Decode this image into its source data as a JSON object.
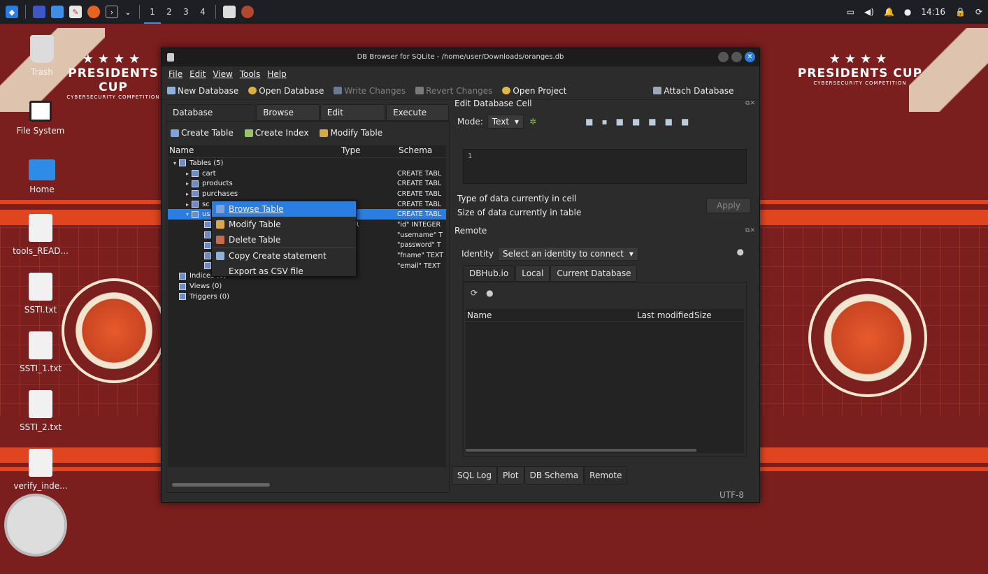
{
  "taskbar": {
    "workspaces": [
      "1",
      "2",
      "3",
      "4"
    ],
    "time": "14:16"
  },
  "desktop": {
    "banner_title": "PRESIDENTS CUP",
    "banner_subtitle": "CYBERSECURITY COMPETITION",
    "icons": [
      {
        "label": "Trash",
        "icon": "trash-icon"
      },
      {
        "label": "File System",
        "icon": "drive-icon"
      },
      {
        "label": "Home",
        "icon": "home-folder-icon"
      },
      {
        "label": "tools_READ...",
        "icon": "text-file-icon"
      },
      {
        "label": "SSTI.txt",
        "icon": "text-file-icon"
      },
      {
        "label": "SSTI_1.txt",
        "icon": "text-file-icon"
      },
      {
        "label": "SSTI_2.txt",
        "icon": "text-file-icon"
      },
      {
        "label": "verify_inde...",
        "icon": "script-file-icon"
      }
    ]
  },
  "window": {
    "title": "DB Browser for SQLite - /home/user/Downloads/oranges.db",
    "menu": [
      "File",
      "Edit",
      "View",
      "Tools",
      "Help"
    ],
    "toolbar": {
      "new_db": "New Database",
      "open_db": "Open Database",
      "write_changes": "Write Changes",
      "revert_changes": "Revert Changes",
      "open_project": "Open Project",
      "attach_db": "Attach Database"
    },
    "tabs": [
      "Database Structure",
      "Browse Data",
      "Edit Pragmas",
      "Execute SQL"
    ],
    "subtool": {
      "create_table": "Create Table",
      "create_index": "Create Index",
      "modify_table": "Modify Table"
    },
    "tree": {
      "columns": [
        "Name",
        "Type",
        "Schema"
      ],
      "rows": [
        {
          "name": "Tables (5)",
          "type": "",
          "schema": "",
          "indent": 0,
          "expand": "▾"
        },
        {
          "name": "cart",
          "type": "",
          "schema": "CREATE TABL",
          "indent": 1,
          "expand": "▸"
        },
        {
          "name": "products",
          "type": "",
          "schema": "CREATE TABL",
          "indent": 1,
          "expand": "▸"
        },
        {
          "name": "purchases",
          "type": "",
          "schema": "CREATE TABL",
          "indent": 1,
          "expand": "▸"
        },
        {
          "name": "sc",
          "type": "",
          "schema": "CREATE TABL",
          "indent": 1,
          "expand": "▸"
        },
        {
          "name": "us",
          "type": "",
          "schema": "CREATE TABL",
          "indent": 1,
          "expand": "▾",
          "selected": true
        },
        {
          "name": "",
          "type": "EGER",
          "schema": "\"id\" INTEGER",
          "indent": 2,
          "expand": ""
        },
        {
          "name": "",
          "type": "T",
          "schema": "\"username\" T",
          "indent": 2,
          "expand": ""
        },
        {
          "name": "",
          "type": "T",
          "schema": "\"password\" T",
          "indent": 2,
          "expand": ""
        },
        {
          "name": "",
          "type": "T",
          "schema": "\"fname\" TEXT",
          "indent": 2,
          "expand": ""
        },
        {
          "name": "",
          "type": "T",
          "schema": "\"email\" TEXT",
          "indent": 2,
          "expand": ""
        },
        {
          "name": "Indices (0)",
          "type": "",
          "schema": "",
          "indent": 0,
          "expand": ""
        },
        {
          "name": "Views (0)",
          "type": "",
          "schema": "",
          "indent": 0,
          "expand": ""
        },
        {
          "name": "Triggers (0)",
          "type": "",
          "schema": "",
          "indent": 0,
          "expand": ""
        }
      ]
    },
    "context_menu": [
      "Browse Table",
      "Modify Table",
      "Delete Table",
      "Copy Create statement",
      "Export as CSV file"
    ],
    "edit_cell": {
      "header": "Edit Database Cell",
      "mode_label": "Mode:",
      "mode_value": "Text",
      "line_number": "1",
      "type_label": "Type of data currently in cell",
      "size_label": "Size of data currently in table",
      "apply": "Apply"
    },
    "remote": {
      "header": "Remote",
      "identity_label": "Identity",
      "identity_value": "Select an identity to connect",
      "tabs": [
        "DBHub.io",
        "Local",
        "Current Database"
      ],
      "columns": [
        "Name",
        "Last modified",
        "Size"
      ]
    },
    "bottom_tabs": [
      "SQL Log",
      "Plot",
      "DB Schema",
      "Remote"
    ],
    "encoding": "UTF-8"
  }
}
